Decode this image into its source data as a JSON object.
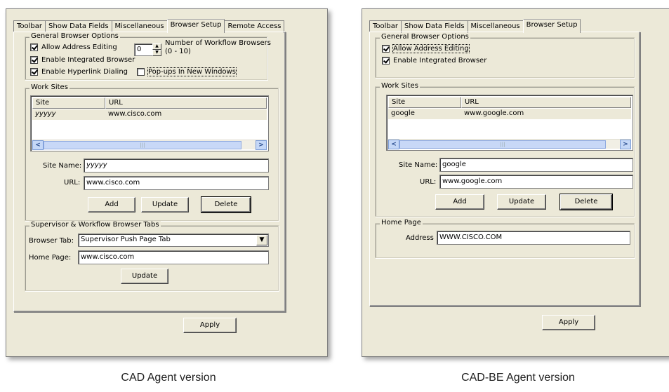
{
  "cad": {
    "tabs": [
      "Toolbar",
      "Show Data Fields",
      "Miscellaneous",
      "Browser Setup",
      "Remote Access"
    ],
    "active_tab": "Browser Setup",
    "general": {
      "title": "General Browser Options",
      "allow_address_editing": "Allow Address Editing",
      "enable_integrated_browser": "Enable Integrated Browser",
      "enable_hyperlink_dialing": "Enable Hyperlink Dialing",
      "popups_new_windows": "Pop-ups In New Windows",
      "workflow_browsers_value": "0",
      "workflow_browsers_label_line1": "Number of Workflow Browsers",
      "workflow_browsers_label_line2": "(0 - 10)"
    },
    "work_sites": {
      "title": "Work Sites",
      "columns": [
        "Site",
        "URL"
      ],
      "rows": [
        {
          "site": "yyyyy",
          "url": "www.cisco.com"
        }
      ],
      "site_name_label": "Site Name:",
      "site_name_value": "yyyyy",
      "url_label": "URL:",
      "url_value": "www.cisco.com",
      "add": "Add",
      "update": "Update",
      "delete": "Delete"
    },
    "supervisor": {
      "title": "Supervisor & Workflow Browser Tabs",
      "browser_tab_label": "Browser Tab:",
      "browser_tab_value": "Supervisor Push Page Tab",
      "home_page_label": "Home Page:",
      "home_page_value": "www.cisco.com",
      "update": "Update"
    },
    "apply": "Apply",
    "caption": "CAD Agent version"
  },
  "cadbe": {
    "tabs": [
      "Toolbar",
      "Show Data Fields",
      "Miscellaneous",
      "Browser Setup"
    ],
    "active_tab": "Browser Setup",
    "general": {
      "title": "General Browser Options",
      "allow_address_editing": "Allow Address Editing",
      "enable_integrated_browser": "Enable Integrated Browser"
    },
    "work_sites": {
      "title": "Work Sites",
      "columns": [
        "Site",
        "URL"
      ],
      "rows": [
        {
          "site": "google",
          "url": "www.google.com"
        }
      ],
      "site_name_label": "Site Name:",
      "site_name_value": "google",
      "url_label": "URL:",
      "url_value": "www.google.com",
      "add": "Add",
      "update": "Update",
      "delete": "Delete"
    },
    "home_page": {
      "title": "Home Page",
      "address_label": "Address",
      "address_value": "WWW.CISCO.COM"
    },
    "apply": "Apply",
    "caption": "CAD-BE Agent version"
  }
}
